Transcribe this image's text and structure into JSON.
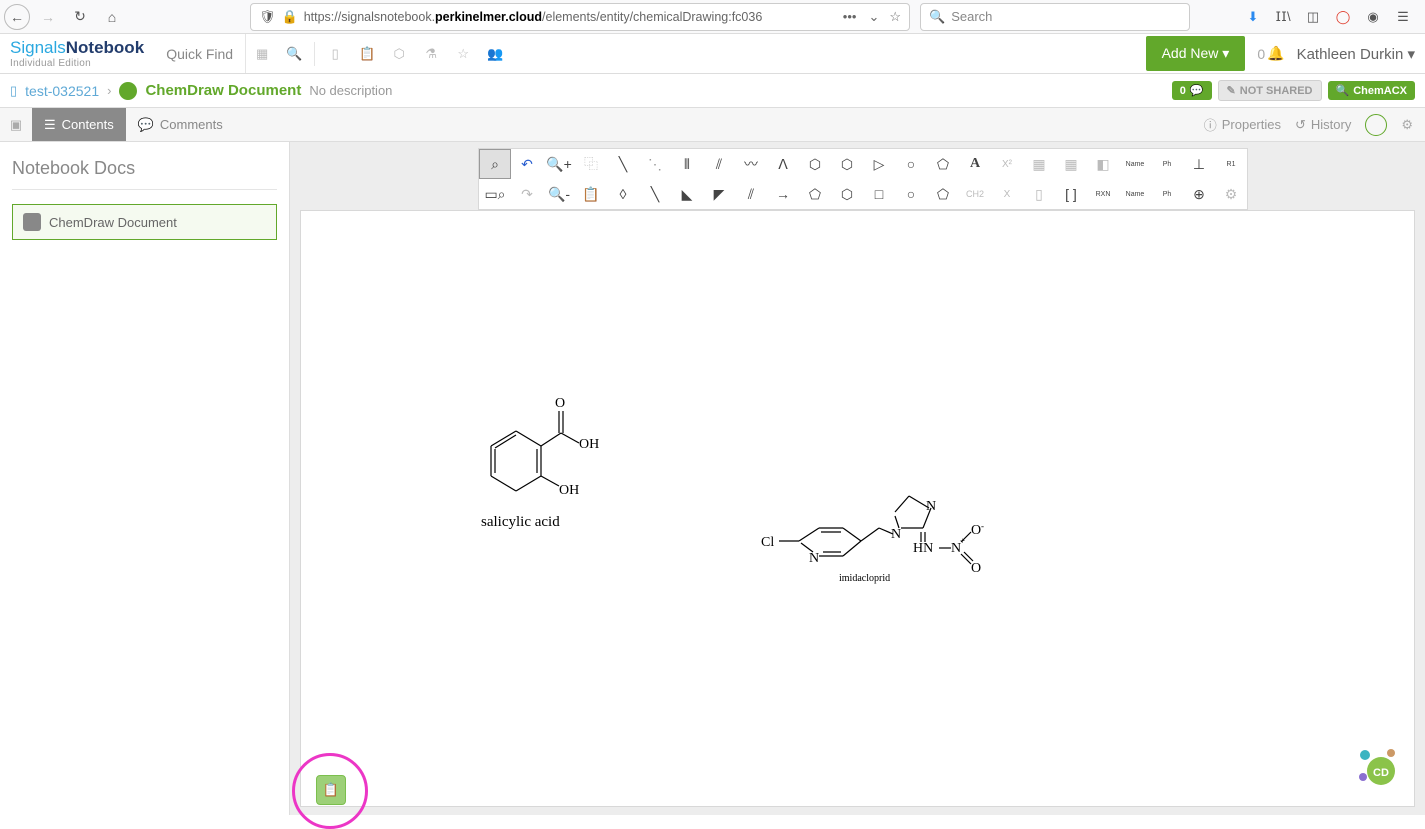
{
  "browser": {
    "url_prefix": "https://signalsnotebook.",
    "url_bold": "perkinelmer.cloud",
    "url_suffix": "/elements/entity/chemicalDrawing:fc036",
    "search_placeholder": "Search"
  },
  "app": {
    "brand1": "Signals",
    "brand2": "Notebook",
    "brand_sub": "Individual Edition",
    "quick_find": "Quick Find",
    "add_new": "Add New",
    "notif_count": "0",
    "user_name": "Kathleen Durkin"
  },
  "breadcrumb": {
    "parent": "test-032521",
    "title": "ChemDraw Document",
    "desc": "No description",
    "comment_count": "0",
    "not_shared": "NOT SHARED",
    "chemacx": "ChemACX"
  },
  "tabs": {
    "contents": "Contents",
    "comments": "Comments",
    "properties": "Properties",
    "history": "History"
  },
  "sidebar": {
    "title": "Notebook Docs",
    "doc_label": "ChemDraw Document"
  },
  "toolbar": {
    "row1_labels": [
      "Name",
      "Ph",
      "",
      "R1"
    ],
    "row2_labels": [
      "CH2",
      "X",
      "RXN",
      "Name",
      "Ph"
    ]
  },
  "molecules": {
    "m1": {
      "name": "salicylic acid",
      "atoms": {
        "o1": "O",
        "oh1": "OH",
        "oh2": "OH"
      }
    },
    "m2": {
      "name": "imidacloprid",
      "atoms": {
        "cl": "Cl",
        "n1": "N",
        "n2": "N",
        "n3": "N",
        "hn": "HN",
        "n4": "N",
        "o1": "O",
        "o2": "O",
        "plus": "+",
        "minus": "-"
      }
    }
  }
}
